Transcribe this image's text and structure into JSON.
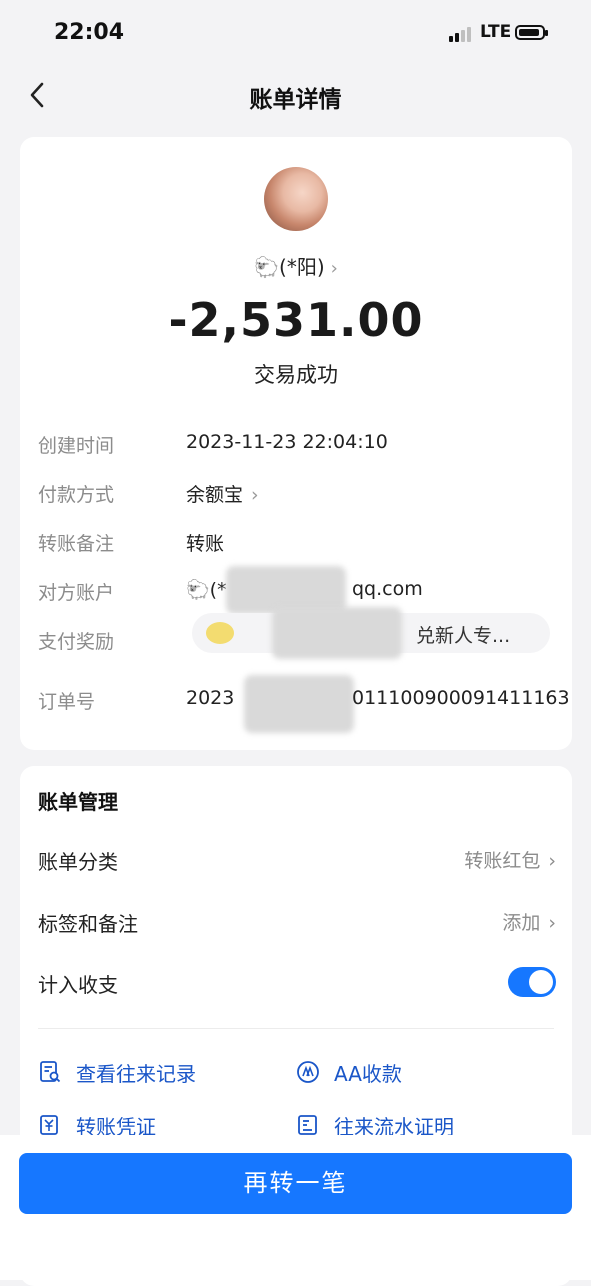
{
  "status_bar": {
    "time": "22:04",
    "network": "LTE"
  },
  "header": {
    "title": "账单详情"
  },
  "summary": {
    "payee": "🐑(*阳)",
    "amount": "-2,531.00",
    "status": "交易成功"
  },
  "details": [
    {
      "label": "创建时间",
      "value": "2023-11-23 22:04:10"
    },
    {
      "label": "付款方式",
      "value": "余额宝"
    },
    {
      "label": "转账备注",
      "value": "转账"
    },
    {
      "label": "对方账户",
      "value_prefix": "🐑(*",
      "value_suffix": "qq.com"
    },
    {
      "label": "支付奖励",
      "value": "兑新人专..."
    },
    {
      "label": "订单号",
      "value_prefix": "2023",
      "value_suffix": "011100900091411163"
    }
  ],
  "bill_management": {
    "title": "账单管理",
    "rows": [
      {
        "label": "账单分类",
        "value": "转账红包"
      },
      {
        "label": "标签和备注",
        "value": "添加"
      },
      {
        "label": "计入收支",
        "toggle_on": true
      }
    ],
    "actions": [
      {
        "label": "查看往来记录",
        "icon": "records-icon"
      },
      {
        "label": "AA收款",
        "icon": "aa-icon"
      },
      {
        "label": "转账凭证",
        "icon": "voucher-icon"
      },
      {
        "label": "往来流水证明",
        "icon": "statement-icon"
      }
    ]
  },
  "footer": {
    "again_button": "再转一笔"
  },
  "colors": {
    "accent": "#1677ff",
    "link": "#1a56c8",
    "background": "#f3f3f5"
  }
}
